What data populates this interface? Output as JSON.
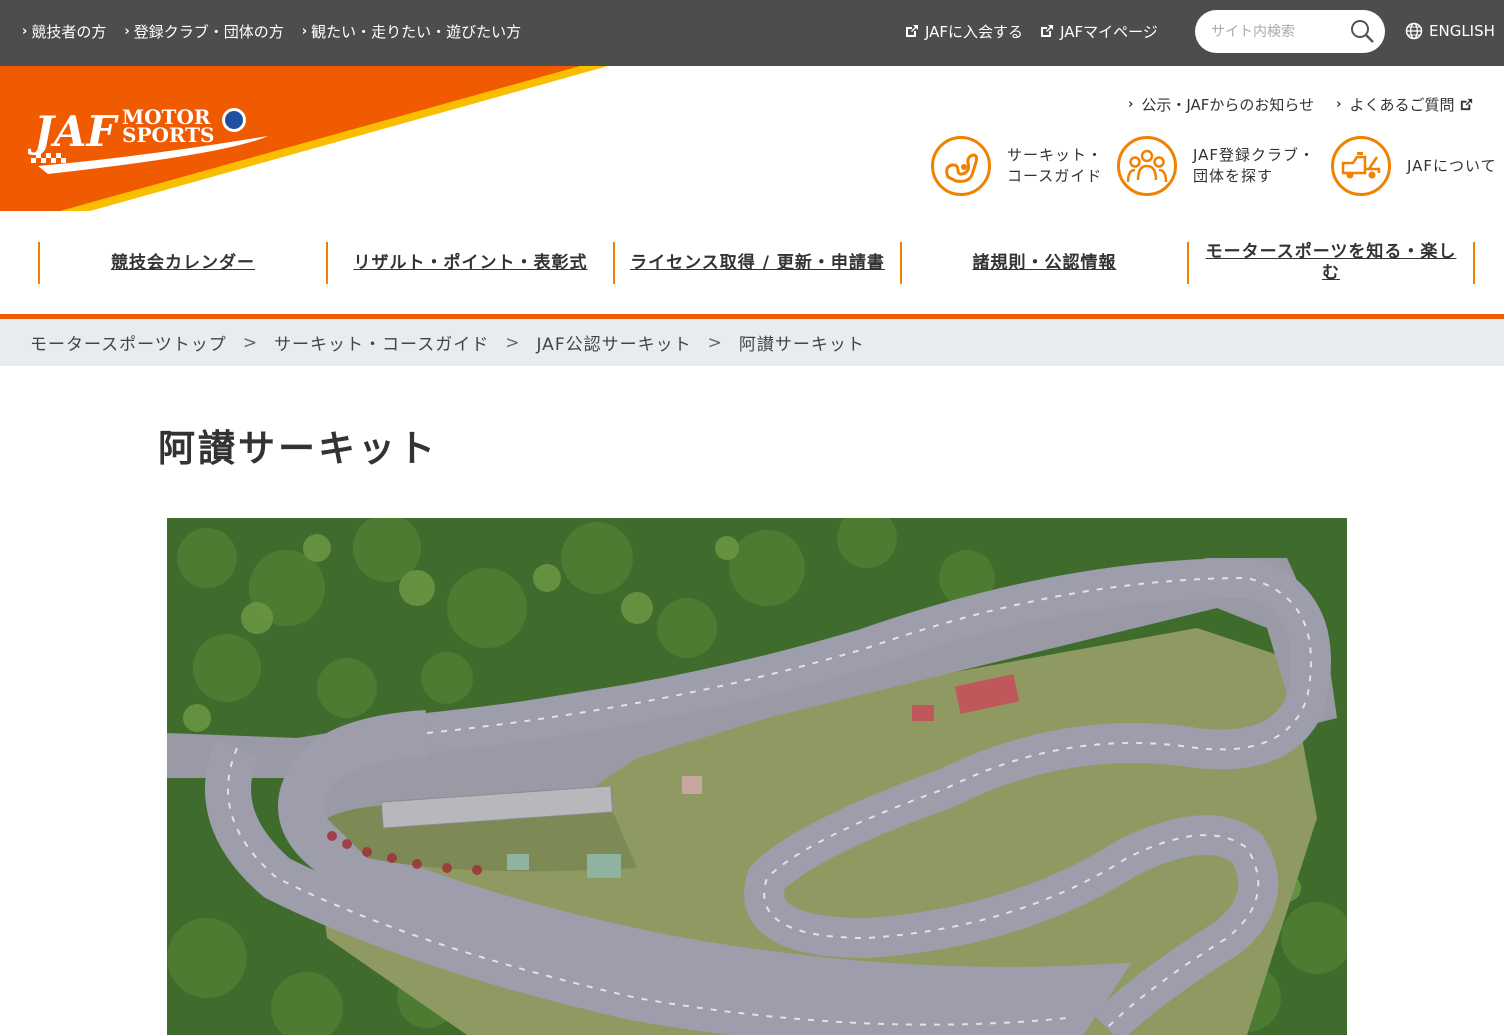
{
  "topbar": {
    "left_links": [
      "競技者の方",
      "登録クラブ・団体の方",
      "観たい・走りたい・遊びたい方"
    ],
    "right_links": [
      "JAFに入会する",
      "JAFマイページ"
    ],
    "search_placeholder": "サイト内検索",
    "language_label": "ENGLISH"
  },
  "header": {
    "logo": {
      "text_main": "JAF",
      "text_sub_1": "MOTOR",
      "text_sub_2": "SPORTS"
    },
    "sub_links": [
      "公示・JAFからのお知らせ",
      "よくあるご質問"
    ],
    "quick_links": [
      {
        "line1": "サーキット・",
        "line2": "コースガイド",
        "icon": "circuit-icon"
      },
      {
        "line1": "JAF登録クラブ・",
        "line2": "団体を探す",
        "icon": "people-group-icon"
      },
      {
        "line1": "JAFについて",
        "line2": "",
        "icon": "tow-truck-icon"
      }
    ],
    "brand_colors": {
      "orange": "#f05a00",
      "yellow": "#fabe00",
      "dark_bar": "#4d4d4d"
    }
  },
  "main_nav": {
    "items": [
      {
        "label": "競技会カレンダー"
      },
      {
        "label": "リザルト・ポイント・表彰式"
      },
      {
        "label": "ライセンス取得 / 更新・申請書"
      },
      {
        "label": "諸規則・公認情報"
      },
      {
        "label_line1": "モータースポーツを知る・楽し",
        "label_line2": "む"
      }
    ]
  },
  "breadcrumb": {
    "items": [
      "モータースポーツトップ",
      "サーキット・コースガイド",
      "JAF公認サーキット",
      "阿讃サーキット"
    ],
    "separator": ">"
  },
  "page": {
    "title": "阿讃サーキット",
    "photo_subject": "aerial-circuit-photo"
  }
}
